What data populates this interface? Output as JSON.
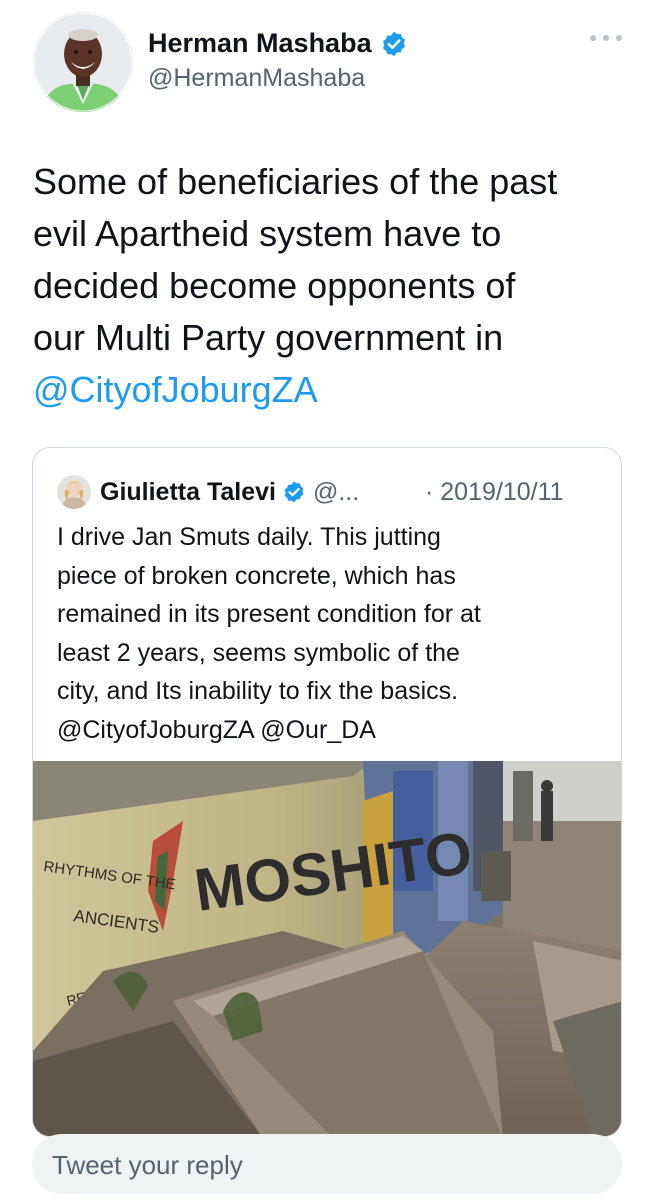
{
  "tweet": {
    "author": {
      "name": "Herman Mashaba",
      "handle": "@HermanMashaba",
      "verified": true,
      "avatar_icon": "profile-photo-man-green-jacket"
    },
    "text_lines": [
      "Some of beneficiaries of the past",
      "evil Apartheid system have to",
      "decided become opponents of",
      "our Multi Party government in"
    ],
    "mention": "@CityofJoburgZA",
    "more_icon": "more-options-icon"
  },
  "quoted_tweet": {
    "author": {
      "name": "Giulietta Talevi",
      "handle": "@...",
      "verified": true,
      "avatar_icon": "profile-photo-woman"
    },
    "date": "· 2019/10/11",
    "text_lines": [
      "I drive Jan Smuts daily. This jutting",
      "piece of broken concrete, which has",
      "remained in its present condition for at",
      "least 2 years, seems symbolic of the",
      "city, and Its inability to fix the basics.",
      "@CityofJoburgZA @Our_DA"
    ],
    "image": {
      "description_icon": "photo-broken-concrete-graffiti-wall",
      "graffiti_text": [
        "RHYTHMS OF THE",
        "ANCIENTS",
        "MOSHITO",
        "REGISTRATION FEE"
      ]
    }
  },
  "reply": {
    "placeholder": "Tweet your reply"
  },
  "colors": {
    "link": "#1d9bf0",
    "text": "#0f1419",
    "secondary": "#536471",
    "border": "#cfd9de",
    "reply_bg": "#eff3f4"
  }
}
